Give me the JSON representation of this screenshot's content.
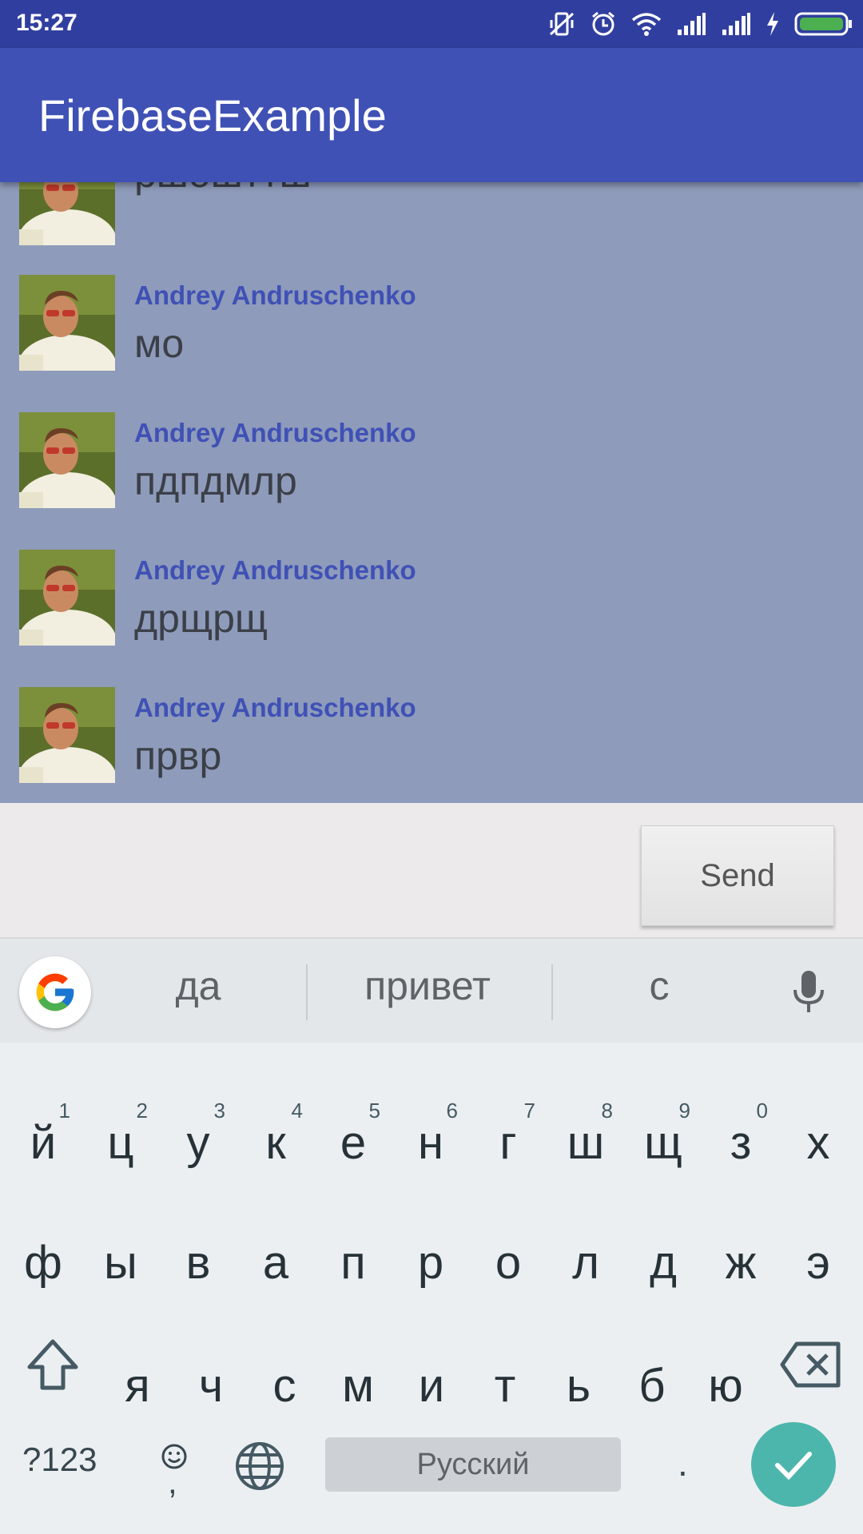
{
  "status_bar": {
    "time": "15:27",
    "icons": [
      "vibrate-off-icon",
      "alarm-icon",
      "wifi-icon",
      "signal-icon",
      "signal-icon",
      "charging-icon",
      "battery-icon"
    ],
    "battery_color": "#4caf50"
  },
  "app_bar": {
    "title": "FirebaseExample",
    "color": "#3f51b5"
  },
  "messages": [
    {
      "author": "",
      "text": "ршошттш"
    },
    {
      "author": "Andrey Andruschenko",
      "text": "мо"
    },
    {
      "author": "Andrey Andruschenko",
      "text": "пдпдмлр"
    },
    {
      "author": "Andrey Andruschenko",
      "text": "дрщрщ"
    },
    {
      "author": "Andrey Andruschenko",
      "text": "првр"
    }
  ],
  "composer": {
    "input_value": "",
    "send_label": "Send"
  },
  "keyboard": {
    "suggestions": [
      "да",
      "привет",
      "с"
    ],
    "row1": [
      {
        "ch": "й",
        "hint": "1"
      },
      {
        "ch": "ц",
        "hint": "2"
      },
      {
        "ch": "у",
        "hint": "3"
      },
      {
        "ch": "к",
        "hint": "4"
      },
      {
        "ch": "е",
        "hint": "5"
      },
      {
        "ch": "н",
        "hint": "6"
      },
      {
        "ch": "г",
        "hint": "7"
      },
      {
        "ch": "ш",
        "hint": "8"
      },
      {
        "ch": "щ",
        "hint": "9"
      },
      {
        "ch": "з",
        "hint": "0"
      },
      {
        "ch": "х",
        "hint": ""
      }
    ],
    "row2": [
      "ф",
      "ы",
      "в",
      "а",
      "п",
      "р",
      "о",
      "л",
      "д",
      "ж",
      "э"
    ],
    "row3": [
      "я",
      "ч",
      "с",
      "м",
      "и",
      "т",
      "ь",
      "б",
      "ю"
    ],
    "symbols_label": "?123",
    "emoji_comma": ",",
    "space_label": "Русский",
    "period_label": ".",
    "enter_color": "#4db6ac"
  }
}
